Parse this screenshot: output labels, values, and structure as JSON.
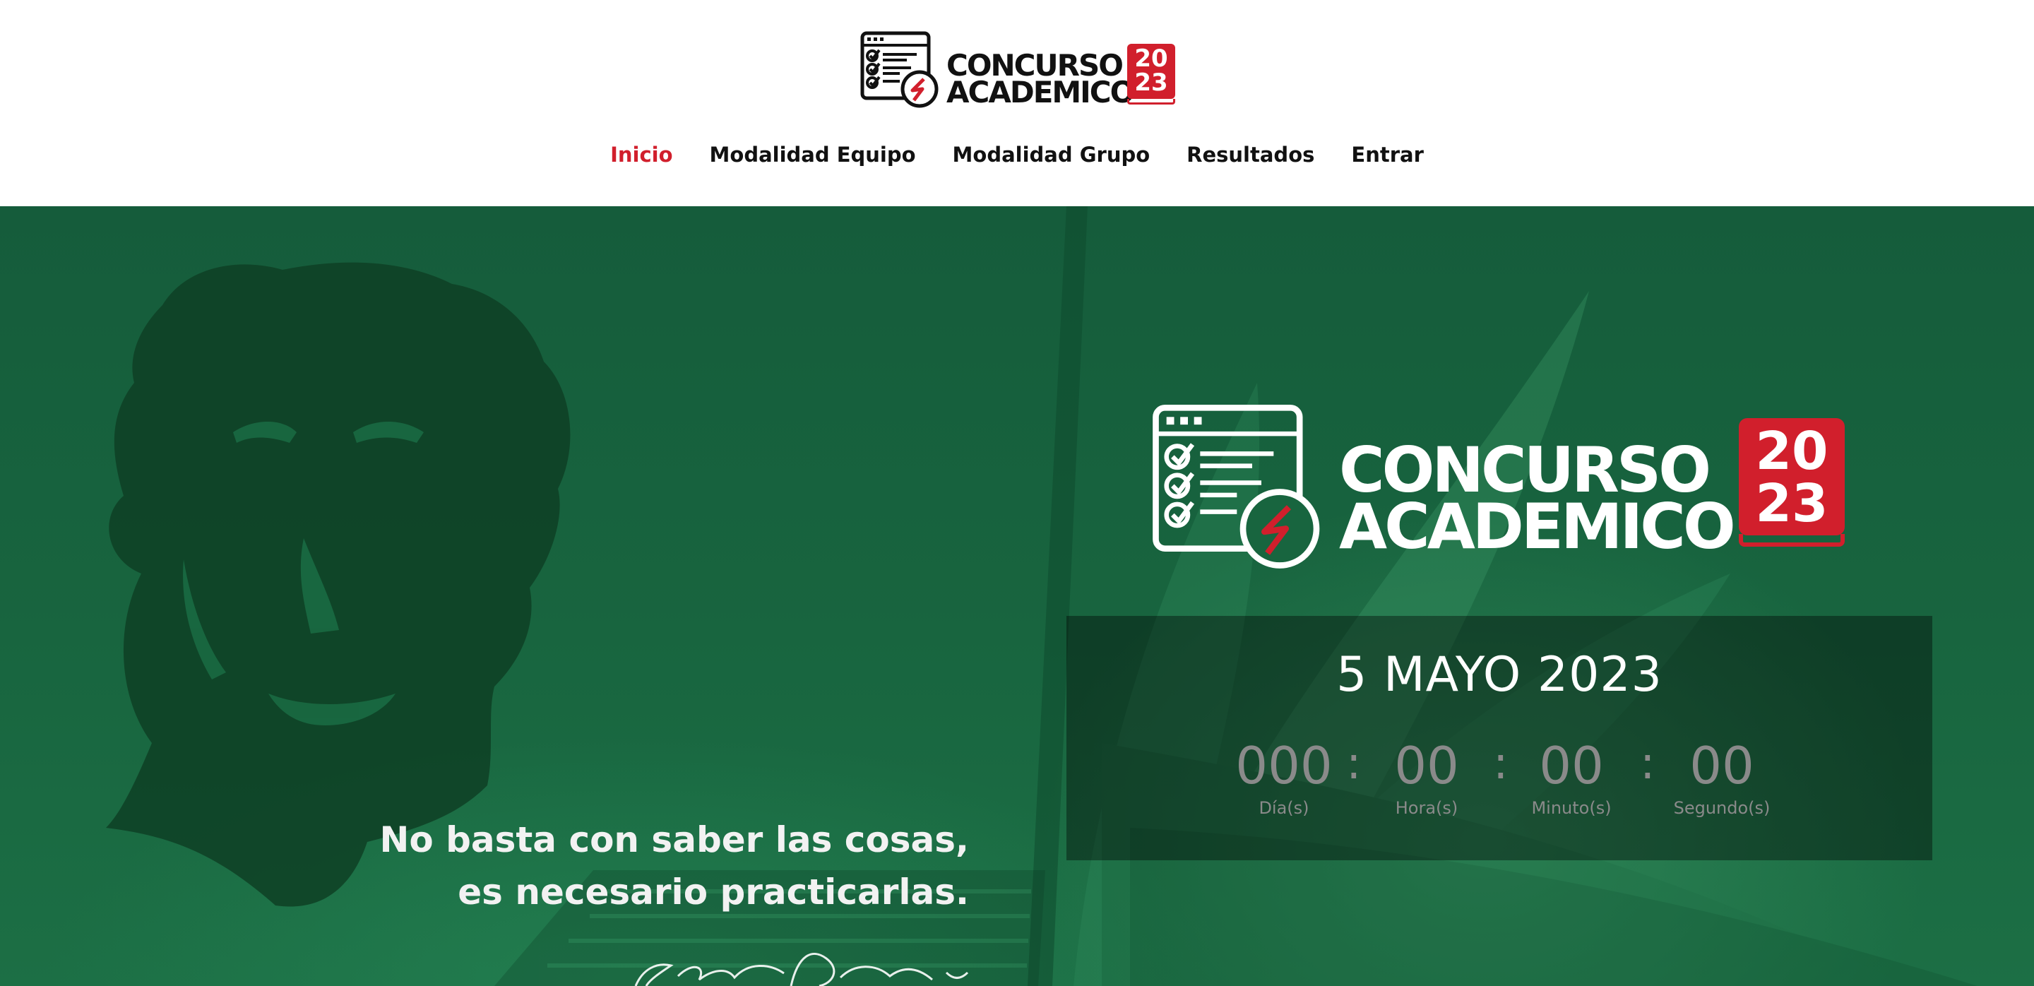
{
  "brand": {
    "line1": "CONCURSO",
    "line2": "ACADEMICO",
    "year_top": "20",
    "year_bottom": "23",
    "brand_red": "#d11f2c",
    "logo_icon": "checklist-document-icon"
  },
  "nav": {
    "items": [
      {
        "label": "Inicio",
        "active": true
      },
      {
        "label": "Modalidad Equipo",
        "active": false
      },
      {
        "label": "Modalidad Grupo",
        "active": false
      },
      {
        "label": "Resultados",
        "active": false
      },
      {
        "label": "Entrar",
        "active": false
      }
    ],
    "active_color": "#d11f2c"
  },
  "hero": {
    "event_date": "5 MAYO 2023",
    "countdown": [
      {
        "value": "000",
        "label": "Día(s)"
      },
      {
        "value": "00",
        "label": "Hora(s)"
      },
      {
        "value": "00",
        "label": "Minuto(s)"
      },
      {
        "value": "00",
        "label": "Segundo(s)"
      }
    ],
    "separator": ":",
    "quote_line1": "No basta con saber las cosas,",
    "quote_line2": "es necesario practicarlas.",
    "background_color": "#18653f"
  }
}
